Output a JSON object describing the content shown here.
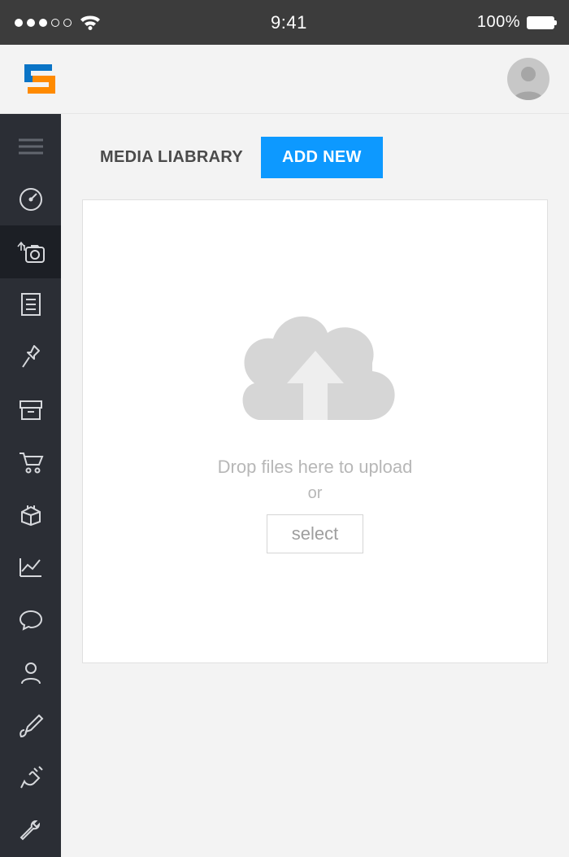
{
  "status_bar": {
    "time": "9:41",
    "battery": "100%"
  },
  "tabs": {
    "library_label": "MEDIA LIABRARY",
    "add_new_label": "ADD NEW"
  },
  "upload": {
    "drop_text": "Drop files here to upload",
    "or_text": "or",
    "select_label": "select"
  },
  "sidebar_icons": [
    "menu-icon",
    "gauge-icon",
    "media-icon",
    "document-icon",
    "pin-icon",
    "archive-icon",
    "cart-icon",
    "box-icon",
    "chart-icon",
    "chat-icon",
    "user-icon",
    "brush-icon",
    "plug-icon",
    "wrench-icon"
  ]
}
